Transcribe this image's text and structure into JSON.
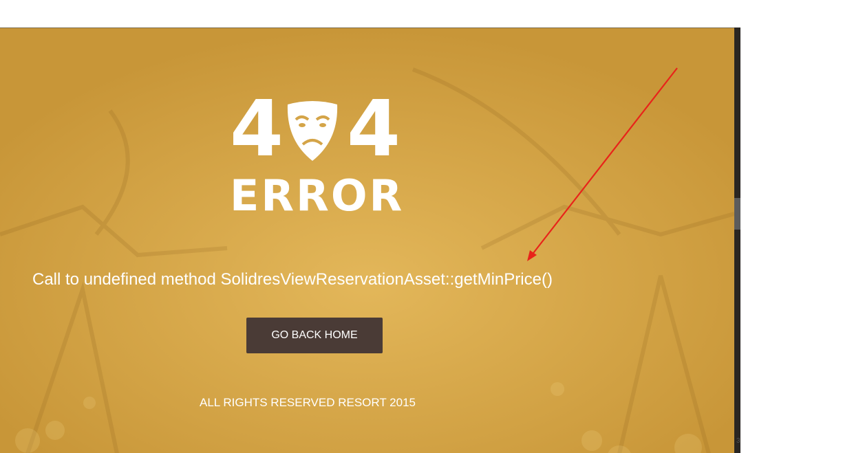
{
  "logo": {
    "left_digit": "4",
    "right_digit": "4",
    "word": "ERROR"
  },
  "error": {
    "message": "Call to undefined method SolidresViewReservationAsset::getMinPrice()"
  },
  "actions": {
    "home_label": "GO BACK HOME"
  },
  "footer": {
    "copyright": "ALL RIGHTS RESERVED RESORT 2015"
  },
  "corner": {
    "number": "3"
  },
  "colors": {
    "background": "#d4a448",
    "button": "#4a3b36",
    "text": "#ffffff",
    "annotation_arrow": "#e8231a"
  },
  "icons": {
    "logo_mask": "sad-theater-mask-icon",
    "annotation": "red-arrow"
  }
}
